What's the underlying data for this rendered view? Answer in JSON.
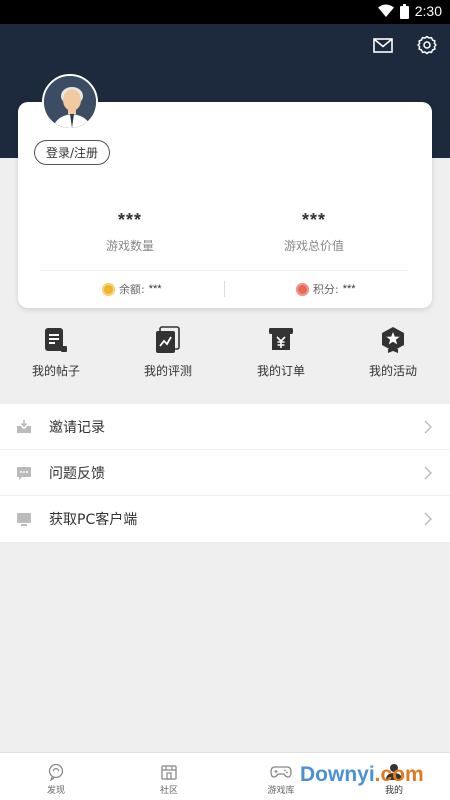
{
  "status_bar": {
    "time": "2:30"
  },
  "header": {
    "icons": [
      "mail-icon",
      "settings-icon"
    ]
  },
  "profile": {
    "login_label": "登录/注册",
    "stats": [
      {
        "value": "***",
        "label": "游戏数量"
      },
      {
        "value": "***",
        "label": "游戏总价值"
      }
    ],
    "balance": {
      "label": "余额:",
      "value": "***"
    },
    "points": {
      "label": "积分:",
      "value": "***"
    }
  },
  "quick_actions": [
    {
      "label": "我的帖子",
      "icon": "posts-icon"
    },
    {
      "label": "我的评测",
      "icon": "review-icon"
    },
    {
      "label": "我的订单",
      "icon": "order-icon"
    },
    {
      "label": "我的活动",
      "icon": "activity-icon"
    }
  ],
  "menu": [
    {
      "label": "邀请记录",
      "icon": "invite-icon"
    },
    {
      "label": "问题反馈",
      "icon": "feedback-icon"
    },
    {
      "label": "获取PC客户端",
      "icon": "pc-icon"
    }
  ],
  "tabs": [
    {
      "label": "发现",
      "icon": "discover-icon"
    },
    {
      "label": "社区",
      "icon": "community-icon"
    },
    {
      "label": "游戏库",
      "icon": "gamepad-icon"
    },
    {
      "label": "我的",
      "icon": "profile-icon",
      "active": true
    }
  ],
  "watermark": {
    "main": "Downyi",
    "tail": ".com"
  },
  "colors": {
    "header_bg": "#1d2a3d",
    "accent_coin": "#f0b429",
    "accent_points": "#e86a55",
    "watermark": "#4a90d9"
  }
}
